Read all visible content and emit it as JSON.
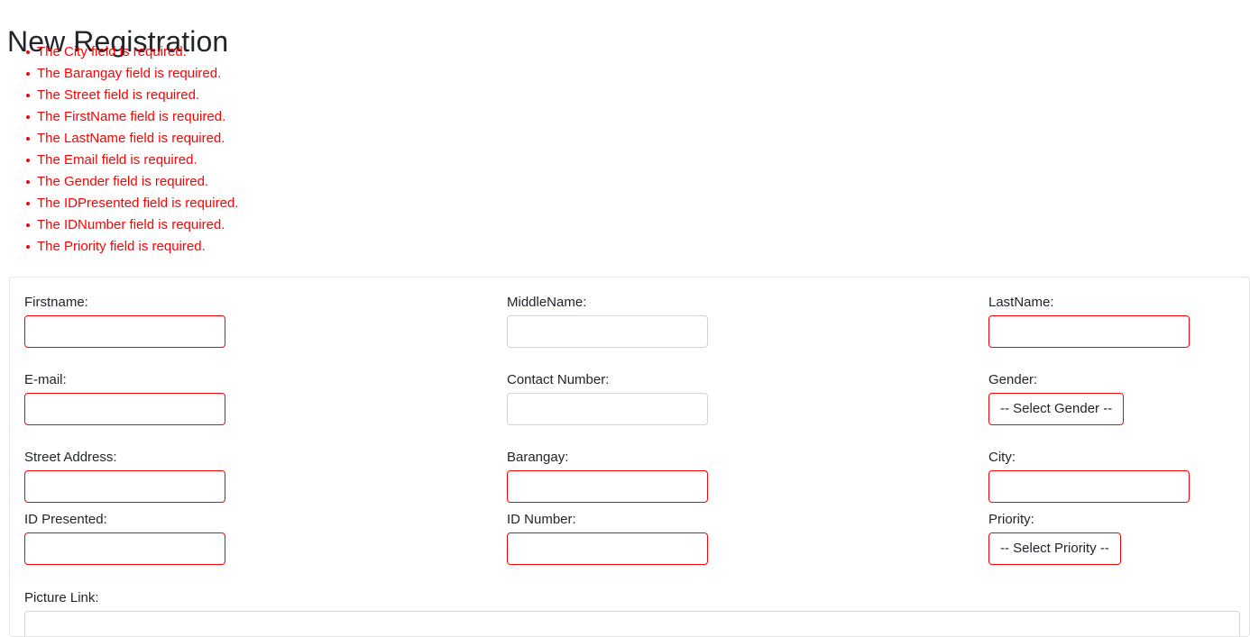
{
  "page": {
    "title": "New Registration"
  },
  "validation": {
    "errors": [
      "The City field is required.",
      "The Barangay field is required.",
      "The Street field is required.",
      "The FirstName field is required.",
      "The LastName field is required.",
      "The Email field is required.",
      "The Gender field is required.",
      "The IDPresented field is required.",
      "The IDNumber field is required.",
      "The Priority field is required."
    ]
  },
  "form": {
    "fields": {
      "firstname": {
        "label": "Firstname:",
        "value": "",
        "placeholder": ""
      },
      "middlename": {
        "label": "MiddleName:",
        "value": "",
        "placeholder": ""
      },
      "lastname": {
        "label": "LastName:",
        "value": "",
        "placeholder": ""
      },
      "email": {
        "label": "E-mail:",
        "value": "",
        "placeholder": ""
      },
      "contact_number": {
        "label": "Contact Number:",
        "value": "",
        "placeholder": ""
      },
      "gender": {
        "label": "Gender:",
        "selected": "-- Select Gender --"
      },
      "street_address": {
        "label": "Street Address:",
        "value": "",
        "placeholder": ""
      },
      "barangay": {
        "label": "Barangay:",
        "value": "",
        "placeholder": ""
      },
      "city": {
        "label": "City:",
        "value": "",
        "placeholder": ""
      },
      "id_presented": {
        "label": "ID Presented:",
        "value": "",
        "placeholder": ""
      },
      "id_number": {
        "label": "ID Number:",
        "value": "",
        "placeholder": ""
      },
      "priority": {
        "label": "Priority:",
        "selected": "-- Select Priority --"
      },
      "picture_link": {
        "label": "Picture Link:",
        "value": "",
        "placeholder": ""
      }
    }
  },
  "colors": {
    "error_red": "#ff0000",
    "text_dark": "#212529",
    "border_gray": "#ced4da",
    "card_border": "#e3e3e3"
  }
}
